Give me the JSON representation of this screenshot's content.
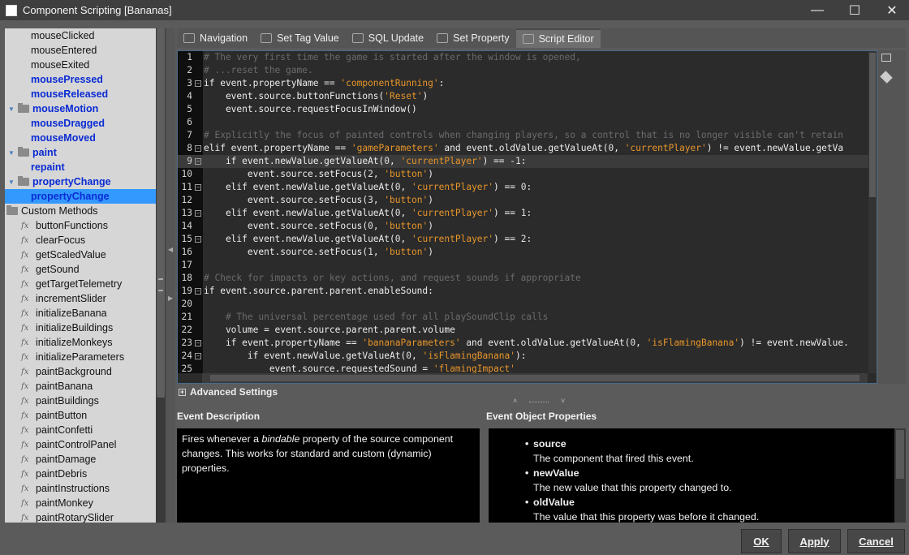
{
  "window": {
    "title": "Component Scripting [Bananas]"
  },
  "tree": [
    {
      "type": "leaf",
      "label": "mouseClicked",
      "style": "plain"
    },
    {
      "type": "leaf",
      "label": "mouseEntered",
      "style": "plain"
    },
    {
      "type": "leaf",
      "label": "mouseExited",
      "style": "plain"
    },
    {
      "type": "leaf",
      "label": "mousePressed",
      "style": "bold"
    },
    {
      "type": "leaf",
      "label": "mouseReleased",
      "style": "bold"
    },
    {
      "type": "folder",
      "label": "mouseMotion",
      "style": "bold"
    },
    {
      "type": "leaf",
      "label": "mouseDragged",
      "style": "bold"
    },
    {
      "type": "leaf",
      "label": "mouseMoved",
      "style": "bold"
    },
    {
      "type": "folder",
      "label": "paint",
      "style": "bold"
    },
    {
      "type": "leaf",
      "label": "repaint",
      "style": "bold"
    },
    {
      "type": "folder",
      "label": "propertyChange",
      "style": "bold"
    },
    {
      "type": "leaf",
      "label": "propertyChange",
      "style": "bold",
      "selected": true
    },
    {
      "type": "root",
      "label": "Custom Methods",
      "style": "plain"
    },
    {
      "type": "method",
      "label": "buttonFunctions"
    },
    {
      "type": "method",
      "label": "clearFocus"
    },
    {
      "type": "method",
      "label": "getScaledValue"
    },
    {
      "type": "method",
      "label": "getSound"
    },
    {
      "type": "method",
      "label": "getTargetTelemetry"
    },
    {
      "type": "method",
      "label": "incrementSlider"
    },
    {
      "type": "method",
      "label": "initializeBanana"
    },
    {
      "type": "method",
      "label": "initializeBuildings"
    },
    {
      "type": "method",
      "label": "initializeMonkeys"
    },
    {
      "type": "method",
      "label": "initializeParameters"
    },
    {
      "type": "method",
      "label": "paintBackground"
    },
    {
      "type": "method",
      "label": "paintBanana"
    },
    {
      "type": "method",
      "label": "paintBuildings"
    },
    {
      "type": "method",
      "label": "paintButton"
    },
    {
      "type": "method",
      "label": "paintConfetti"
    },
    {
      "type": "method",
      "label": "paintControlPanel"
    },
    {
      "type": "method",
      "label": "paintDamage"
    },
    {
      "type": "method",
      "label": "paintDebris"
    },
    {
      "type": "method",
      "label": "paintInstructions"
    },
    {
      "type": "method",
      "label": "paintMonkey"
    },
    {
      "type": "method",
      "label": "paintRotarySlider"
    }
  ],
  "tabs": [
    {
      "label": "Navigation",
      "active": false
    },
    {
      "label": "Set Tag Value",
      "active": false
    },
    {
      "label": "SQL Update",
      "active": false
    },
    {
      "label": "Set Property",
      "active": false
    },
    {
      "label": "Script Editor",
      "active": true
    }
  ],
  "code": [
    {
      "n": "1",
      "fold": false,
      "segs": [
        [
          "cm",
          "# The very first time the game is started after the window is opened,"
        ]
      ]
    },
    {
      "n": "2",
      "fold": false,
      "segs": [
        [
          "cm",
          "# ...reset the game."
        ]
      ]
    },
    {
      "n": "3",
      "fold": true,
      "segs": [
        [
          "kw",
          "if event.propertyName == "
        ],
        [
          "st",
          "'componentRunning'"
        ],
        [
          "kw",
          ":"
        ]
      ]
    },
    {
      "n": "4",
      "fold": false,
      "segs": [
        [
          "kw",
          "    event.source.buttonFunctions("
        ],
        [
          "st",
          "'Reset'"
        ],
        [
          "kw",
          ")"
        ]
      ]
    },
    {
      "n": "5",
      "fold": false,
      "segs": [
        [
          "kw",
          "    event.source.requestFocusInWindow()"
        ]
      ]
    },
    {
      "n": "6",
      "fold": false,
      "segs": [
        [
          "kw",
          ""
        ]
      ]
    },
    {
      "n": "7",
      "fold": false,
      "segs": [
        [
          "cm",
          "# Explicitly the focus of painted controls when changing players, so a control that is no longer visible can't retain"
        ]
      ]
    },
    {
      "n": "8",
      "fold": true,
      "segs": [
        [
          "kw",
          "elif event.propertyName == "
        ],
        [
          "st",
          "'gameParameters'"
        ],
        [
          "kw",
          " and event.oldValue.getValueAt("
        ],
        [
          "nm",
          "0"
        ],
        [
          "kw",
          ", "
        ],
        [
          "st",
          "'currentPlayer'"
        ],
        [
          "kw",
          ") != event.newValue.getVa"
        ]
      ]
    },
    {
      "n": "9",
      "fold": true,
      "current": true,
      "segs": [
        [
          "kw",
          "    if event.newValue.getValueAt("
        ],
        [
          "nm",
          "0"
        ],
        [
          "kw",
          ", "
        ],
        [
          "st",
          "'currentPlayer'"
        ],
        [
          "kw",
          ") == -"
        ],
        [
          "nm",
          "1"
        ],
        [
          "kw",
          ":"
        ]
      ]
    },
    {
      "n": "10",
      "fold": false,
      "segs": [
        [
          "kw",
          "        event.source.setFocus("
        ],
        [
          "nm",
          "2"
        ],
        [
          "kw",
          ", "
        ],
        [
          "st",
          "'button'"
        ],
        [
          "kw",
          ")"
        ]
      ]
    },
    {
      "n": "11",
      "fold": true,
      "segs": [
        [
          "kw",
          "    elif event.newValue.getValueAt("
        ],
        [
          "nm",
          "0"
        ],
        [
          "kw",
          ", "
        ],
        [
          "st",
          "'currentPlayer'"
        ],
        [
          "kw",
          ") == "
        ],
        [
          "nm",
          "0"
        ],
        [
          "kw",
          ":"
        ]
      ]
    },
    {
      "n": "12",
      "fold": false,
      "segs": [
        [
          "kw",
          "        event.source.setFocus("
        ],
        [
          "nm",
          "3"
        ],
        [
          "kw",
          ", "
        ],
        [
          "st",
          "'button'"
        ],
        [
          "kw",
          ")"
        ]
      ]
    },
    {
      "n": "13",
      "fold": true,
      "segs": [
        [
          "kw",
          "    elif event.newValue.getValueAt("
        ],
        [
          "nm",
          "0"
        ],
        [
          "kw",
          ", "
        ],
        [
          "st",
          "'currentPlayer'"
        ],
        [
          "kw",
          ") == "
        ],
        [
          "nm",
          "1"
        ],
        [
          "kw",
          ":"
        ]
      ]
    },
    {
      "n": "14",
      "fold": false,
      "segs": [
        [
          "kw",
          "        event.source.setFocus("
        ],
        [
          "nm",
          "0"
        ],
        [
          "kw",
          ", "
        ],
        [
          "st",
          "'button'"
        ],
        [
          "kw",
          ")"
        ]
      ]
    },
    {
      "n": "15",
      "fold": true,
      "segs": [
        [
          "kw",
          "    elif event.newValue.getValueAt("
        ],
        [
          "nm",
          "0"
        ],
        [
          "kw",
          ", "
        ],
        [
          "st",
          "'currentPlayer'"
        ],
        [
          "kw",
          ") == "
        ],
        [
          "nm",
          "2"
        ],
        [
          "kw",
          ":"
        ]
      ]
    },
    {
      "n": "16",
      "fold": false,
      "segs": [
        [
          "kw",
          "        event.source.setFocus("
        ],
        [
          "nm",
          "1"
        ],
        [
          "kw",
          ", "
        ],
        [
          "st",
          "'button'"
        ],
        [
          "kw",
          ")"
        ]
      ]
    },
    {
      "n": "17",
      "fold": false,
      "segs": [
        [
          "kw",
          ""
        ]
      ]
    },
    {
      "n": "18",
      "fold": false,
      "segs": [
        [
          "cm",
          "# Check for impacts or key actions, and request sounds if appropriate"
        ]
      ]
    },
    {
      "n": "19",
      "fold": true,
      "segs": [
        [
          "kw",
          "if event.source.parent.parent.enableSound:"
        ]
      ]
    },
    {
      "n": "20",
      "fold": false,
      "segs": [
        [
          "kw",
          ""
        ]
      ]
    },
    {
      "n": "21",
      "fold": false,
      "segs": [
        [
          "cm",
          "    # The universal percentage used for all playSoundClip calls"
        ]
      ]
    },
    {
      "n": "22",
      "fold": false,
      "segs": [
        [
          "kw",
          "    volume = event.source.parent.parent.volume"
        ]
      ]
    },
    {
      "n": "23",
      "fold": true,
      "segs": [
        [
          "kw",
          "    if event.propertyName == "
        ],
        [
          "st",
          "'bananaParameters'"
        ],
        [
          "kw",
          " and event.oldValue.getValueAt("
        ],
        [
          "nm",
          "0"
        ],
        [
          "kw",
          ", "
        ],
        [
          "st",
          "'isFlamingBanana'"
        ],
        [
          "kw",
          ") != event.newValue."
        ]
      ]
    },
    {
      "n": "24",
      "fold": true,
      "segs": [
        [
          "kw",
          "        if event.newValue.getValueAt("
        ],
        [
          "nm",
          "0"
        ],
        [
          "kw",
          ", "
        ],
        [
          "st",
          "'isFlamingBanana'"
        ],
        [
          "kw",
          "):"
        ]
      ]
    },
    {
      "n": "25",
      "fold": false,
      "segs": [
        [
          "kw",
          "            event.source.requestedSound = "
        ],
        [
          "st",
          "'flamingImpact'"
        ]
      ]
    }
  ],
  "advanced": {
    "label": "Advanced Settings"
  },
  "description": {
    "title": "Event Description",
    "text_before": "Fires whenever a ",
    "text_em": "bindable",
    "text_after": " property of the source component changes. This works for standard and custom (dynamic) properties."
  },
  "properties": {
    "title": "Event Object Properties",
    "items": [
      {
        "name": "source",
        "desc": "The component that fired this event."
      },
      {
        "name": "newValue",
        "desc": "The new value that this property changed to."
      },
      {
        "name": "oldValue",
        "desc": "The value that this property was before it changed."
      }
    ]
  },
  "buttons": {
    "ok": "OK",
    "apply": "Apply",
    "cancel": "Cancel"
  },
  "colors": {
    "selection": "#3399ff",
    "event_label": "#0a2bd4",
    "string": "#e8962a",
    "comment": "#6b6b6b"
  }
}
